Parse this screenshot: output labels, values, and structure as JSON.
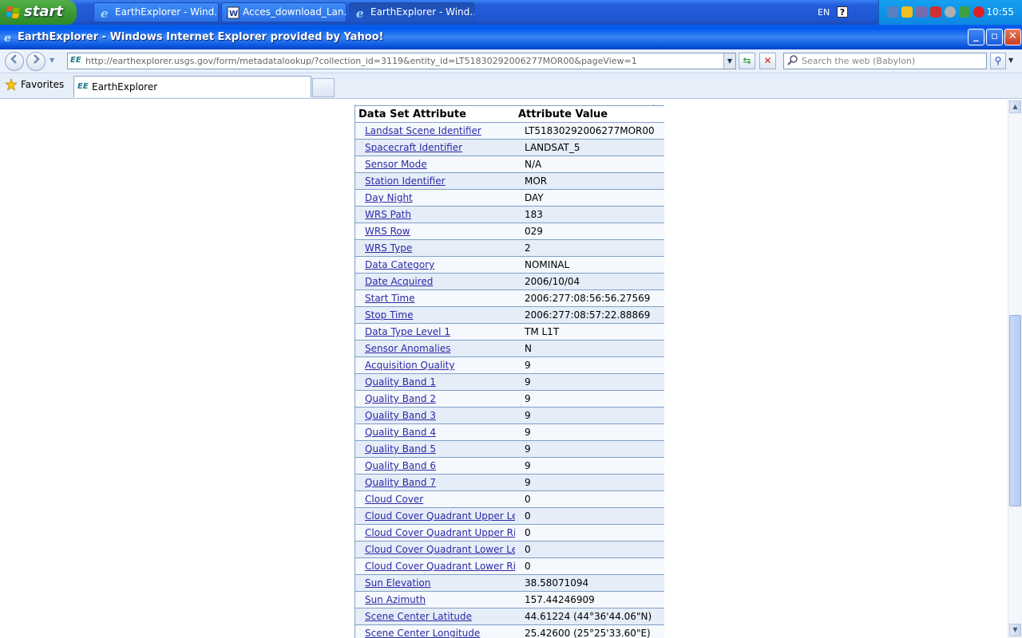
{
  "taskbar": {
    "start_label": "start",
    "tasks": [
      {
        "label": "EarthExplorer - Wind..."
      },
      {
        "label": "Acces_download_Lan..."
      },
      {
        "label": "EarthExplorer - Wind..."
      }
    ],
    "lang": "EN",
    "help": "?",
    "clock": "10:55"
  },
  "window": {
    "title": "EarthExplorer - Windows Internet Explorer provided by Yahoo!"
  },
  "address_bar": {
    "badge": "EE",
    "url": "http://earthexplorer.usgs.gov/form/metadatalookup/?collection_id=3119&entity_id=LT51830292006277MOR00&pageView=1",
    "search_placeholder": "Search the web (Babylon)"
  },
  "tabs": {
    "favorites_label": "Favorites",
    "active_tab_label": "EarthExplorer",
    "active_tab_badge": "EE"
  },
  "metadata": {
    "header_attribute": "Data Set Attribute",
    "header_value": "Attribute Value",
    "rows": [
      {
        "attr": "Landsat Scene Identifier",
        "value": "LT51830292006277MOR00"
      },
      {
        "attr": "Spacecraft Identifier",
        "value": "LANDSAT_5"
      },
      {
        "attr": "Sensor Mode",
        "value": "N/A"
      },
      {
        "attr": "Station Identifier",
        "value": "MOR"
      },
      {
        "attr": "Day Night",
        "value": "DAY"
      },
      {
        "attr": "WRS Path",
        "value": "183"
      },
      {
        "attr": "WRS Row",
        "value": "029"
      },
      {
        "attr": "WRS Type",
        "value": "2"
      },
      {
        "attr": "Data Category",
        "value": "NOMINAL"
      },
      {
        "attr": "Date Acquired",
        "value": "2006/10/04"
      },
      {
        "attr": "Start Time",
        "value": "2006:277:08:56:56.27569"
      },
      {
        "attr": "Stop Time",
        "value": "2006:277:08:57:22.88869"
      },
      {
        "attr": "Data Type Level 1",
        "value": "TM L1T"
      },
      {
        "attr": "Sensor Anomalies",
        "value": "N"
      },
      {
        "attr": "Acquisition Quality",
        "value": "9"
      },
      {
        "attr": "Quality Band 1",
        "value": "9"
      },
      {
        "attr": "Quality Band 2",
        "value": "9"
      },
      {
        "attr": "Quality Band 3",
        "value": "9"
      },
      {
        "attr": "Quality Band 4",
        "value": "9"
      },
      {
        "attr": "Quality Band 5",
        "value": "9"
      },
      {
        "attr": "Quality Band 6",
        "value": "9"
      },
      {
        "attr": "Quality Band 7",
        "value": "9"
      },
      {
        "attr": "Cloud Cover",
        "value": "0"
      },
      {
        "attr": "Cloud Cover Quadrant Upper Lef",
        "value": "0"
      },
      {
        "attr": "Cloud Cover Quadrant Upper Rig",
        "value": "0"
      },
      {
        "attr": "Cloud Cover Quadrant Lower Lef",
        "value": "0"
      },
      {
        "attr": "Cloud Cover Quadrant Lower Rig",
        "value": "0"
      },
      {
        "attr": "Sun Elevation",
        "value": "38.58071094"
      },
      {
        "attr": "Sun Azimuth",
        "value": "157.44246909"
      },
      {
        "attr": "Scene Center Latitude",
        "value": "44.61224 (44°36'44.06\"N)"
      },
      {
        "attr": "Scene Center Longitude",
        "value": "25.42600 (25°25'33.60\"E)"
      }
    ]
  }
}
